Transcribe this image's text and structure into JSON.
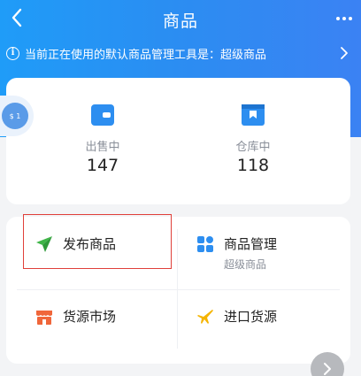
{
  "header": {
    "title": "商品"
  },
  "notice": {
    "text": "当前正在使用的默认商品管理工具是：超级商品"
  },
  "stats": [
    {
      "label": "出售中",
      "value": "147",
      "icon": "wallet-icon"
    },
    {
      "label": "仓库中",
      "value": "118",
      "icon": "warehouse-icon"
    }
  ],
  "side_bubble": {
    "text": "$ 1"
  },
  "tools": [
    {
      "label": "发布商品",
      "sub": "",
      "icon": "paper-plane-icon",
      "color": "#3fb548"
    },
    {
      "label": "商品管理",
      "sub": "超级商品",
      "icon": "grid-icon",
      "color": "#2d8ef0"
    },
    {
      "label": "货源市场",
      "sub": "",
      "icon": "store-icon",
      "color": "#f0663a"
    },
    {
      "label": "进口货源",
      "sub": "",
      "icon": "airplane-icon",
      "color": "#f5b400"
    }
  ],
  "colors": {
    "brand_blue": "#2a8ef2",
    "highlight_red": "#e0403a"
  }
}
